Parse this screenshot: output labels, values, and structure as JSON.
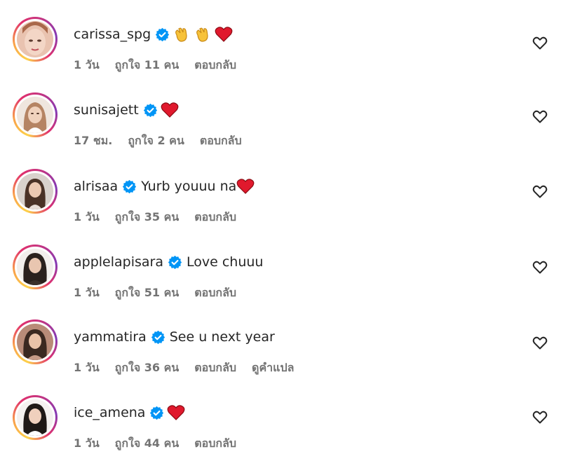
{
  "comments": [
    {
      "username": "carissa_spg",
      "text": "",
      "emojis": [
        "clapping-hands",
        "clapping-hands",
        "red-heart"
      ],
      "time": "1 วัน",
      "likes": "ถูกใจ 11 คน",
      "reply": "ตอบกลับ",
      "translate": ""
    },
    {
      "username": "sunisajett",
      "text": "",
      "emojis": [
        "red-heart"
      ],
      "time": "17 ชม.",
      "likes": "ถูกใจ 2 คน",
      "reply": "ตอบกลับ",
      "translate": ""
    },
    {
      "username": "alrisaa",
      "text": "Yurb youuu na",
      "emojis": [
        "red-heart"
      ],
      "time": "1 วัน",
      "likes": "ถูกใจ 35 คน",
      "reply": "ตอบกลับ",
      "translate": ""
    },
    {
      "username": "applelapisara",
      "text": "Love chuuu",
      "emojis": [],
      "time": "1 วัน",
      "likes": "ถูกใจ 51 คน",
      "reply": "ตอบกลับ",
      "translate": ""
    },
    {
      "username": "yammatira",
      "text": "See u next year",
      "emojis": [],
      "time": "1 วัน",
      "likes": "ถูกใจ 36 คน",
      "reply": "ตอบกลับ",
      "translate": "ดูคำแปล"
    },
    {
      "username": "ice_amena",
      "text": "",
      "emojis": [
        "red-heart"
      ],
      "time": "1 วัน",
      "likes": "ถูกใจ 44 คน",
      "reply": "ตอบกลับ",
      "translate": ""
    }
  ],
  "colors": {
    "text": "#262626",
    "meta": "#737373",
    "verified": "#0095f6",
    "heart_emoji": "#e0192d",
    "clap_emoji": "#f7c239"
  },
  "icons": {
    "verified": "verified-badge-icon",
    "like": "heart-outline-icon",
    "avatar_ring": "story-ring"
  }
}
